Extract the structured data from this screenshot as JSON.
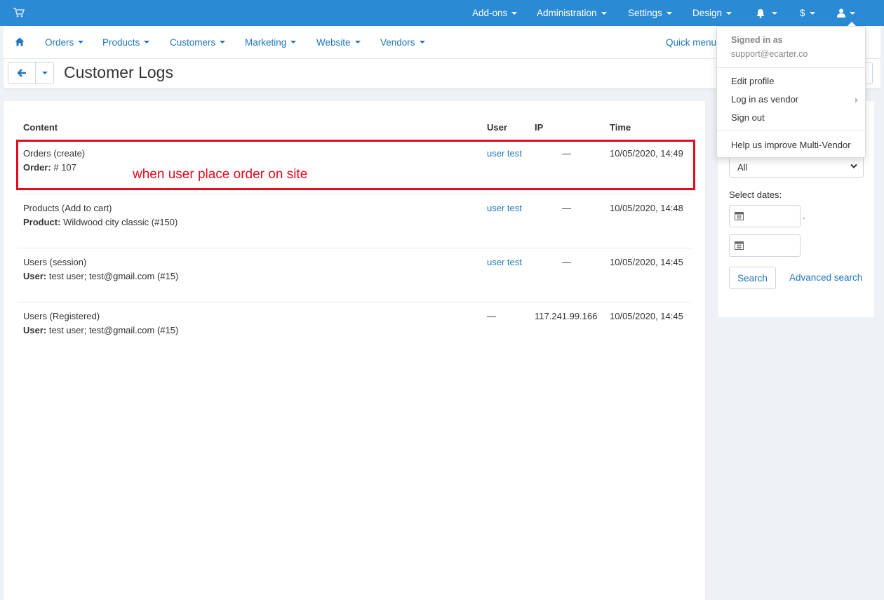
{
  "topbar": {
    "cart_icon": "shopping-cart-icon",
    "menus": [
      "Add-ons",
      "Administration",
      "Settings",
      "Design"
    ],
    "bell_icon": "bell-icon",
    "currency": "$",
    "user_icon": "user-icon",
    "bg_color": "#2a8ad4"
  },
  "nav": {
    "home_icon": "home-icon",
    "items": [
      "Orders",
      "Products",
      "Customers",
      "Marketing",
      "Website",
      "Vendors"
    ],
    "quick_menu": "Quick menu"
  },
  "page": {
    "title": "Customer Logs",
    "back_icon": "arrow-left-icon"
  },
  "table": {
    "headers": {
      "content": "Content",
      "user": "User",
      "ip": "IP",
      "time": "Time"
    },
    "rows": [
      {
        "content": "Orders (create)",
        "detail_label": "Order:",
        "detail_value": " # 107",
        "user": "user test",
        "ip": "—",
        "time": "10/05/2020, 14:49"
      },
      {
        "content": "Products (Add to cart)",
        "detail_label": "Product:",
        "detail_value": " Wildwood city classic (#150)",
        "user": "user test",
        "ip": "—",
        "time": "10/05/2020, 14:48"
      },
      {
        "content": "Users (session)",
        "detail_label": "User:",
        "detail_value": " test user; test@gmail.com (#15)",
        "user": "user test",
        "ip": "—",
        "time": "10/05/2020, 14:45"
      },
      {
        "content": "Users (Registered)",
        "detail_label": "User:",
        "detail_value": " test user; test@gmail.com (#15)",
        "user": "—",
        "ip": "117.241.99.166",
        "time": "10/05/2020, 14:45"
      }
    ]
  },
  "annotation": {
    "text": "when user place order on site",
    "color": "#e8091b"
  },
  "sidebar": {
    "select_value": "All",
    "select_dates_label": "Select dates:",
    "date_separator": "-",
    "search_button": "Search",
    "advanced_search": "Advanced search"
  },
  "user_dropdown": {
    "signed_in_label": "Signed in as",
    "email": "support@ecarter.co",
    "items": [
      "Edit profile",
      "Log in as vendor",
      "Sign out"
    ],
    "footer_item": "Help us improve Multi-Vendor"
  }
}
